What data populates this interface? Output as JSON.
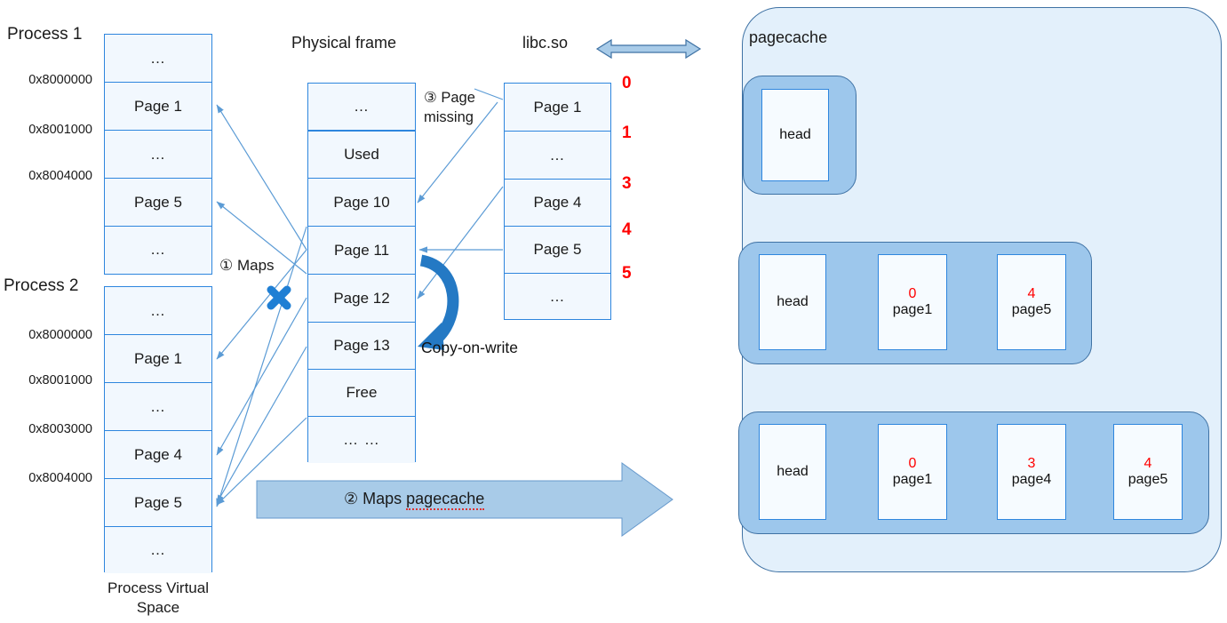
{
  "diagram": {
    "title_process1": "Process 1",
    "title_process2": "Process 2",
    "title_physical_frame": "Physical frame",
    "title_libc": "libc.so",
    "title_pagecache": "pagecache",
    "caption_virtual_space_line1": "Process Virtual",
    "caption_virtual_space_line2": "Space"
  },
  "process1": {
    "addresses": [
      "0x8000000",
      "0x8001000",
      "0x8004000"
    ],
    "cells": [
      "…",
      "Page 1",
      "…",
      "Page 5",
      "…"
    ]
  },
  "process2": {
    "addresses": [
      "0x8000000",
      "0x8001000",
      "0x8003000",
      "0x8004000"
    ],
    "cells": [
      "…",
      "Page 1",
      "…",
      "Page 4",
      "Page 5",
      "…"
    ]
  },
  "physical_frame": {
    "cells": [
      "…",
      "Used",
      "Page 10",
      "Page 11",
      "Page 12",
      "Page 13",
      "Free",
      "… …"
    ]
  },
  "libc": {
    "cells": [
      "Page 1",
      "…",
      "Page 4",
      "Page 5",
      "…"
    ],
    "indices": [
      "0",
      "1",
      "3",
      "4",
      "5"
    ]
  },
  "annotations": {
    "maps": "① Maps",
    "maps_pagecache_prefix": "② Maps ",
    "maps_pagecache_word": "pagecache",
    "page_missing_line1": "③ Page",
    "page_missing_line2": "missing",
    "copy_on_write": "Copy-on-write"
  },
  "pagecache": {
    "stages": [
      {
        "nodes": [
          {
            "idx": "",
            "name": "head"
          }
        ]
      },
      {
        "nodes": [
          {
            "idx": "",
            "name": "head"
          },
          {
            "idx": "0",
            "name": "page1"
          },
          {
            "idx": "4",
            "name": "page5"
          }
        ]
      },
      {
        "nodes": [
          {
            "idx": "",
            "name": "head"
          },
          {
            "idx": "0",
            "name": "page1"
          },
          {
            "idx": "3",
            "name": "page4"
          },
          {
            "idx": "4",
            "name": "page5"
          }
        ]
      }
    ]
  },
  "colors": {
    "box_border": "#2e86de",
    "box_fill": "#f2f8fe",
    "red": "#ff0000",
    "pagecache_outer": "#e3f0fb",
    "pagecache_group": "#9dc7ec",
    "arrow_blue": "#2e86de",
    "banner_fill": "#a8cbe8",
    "bold_arrow": "#2479c4"
  }
}
